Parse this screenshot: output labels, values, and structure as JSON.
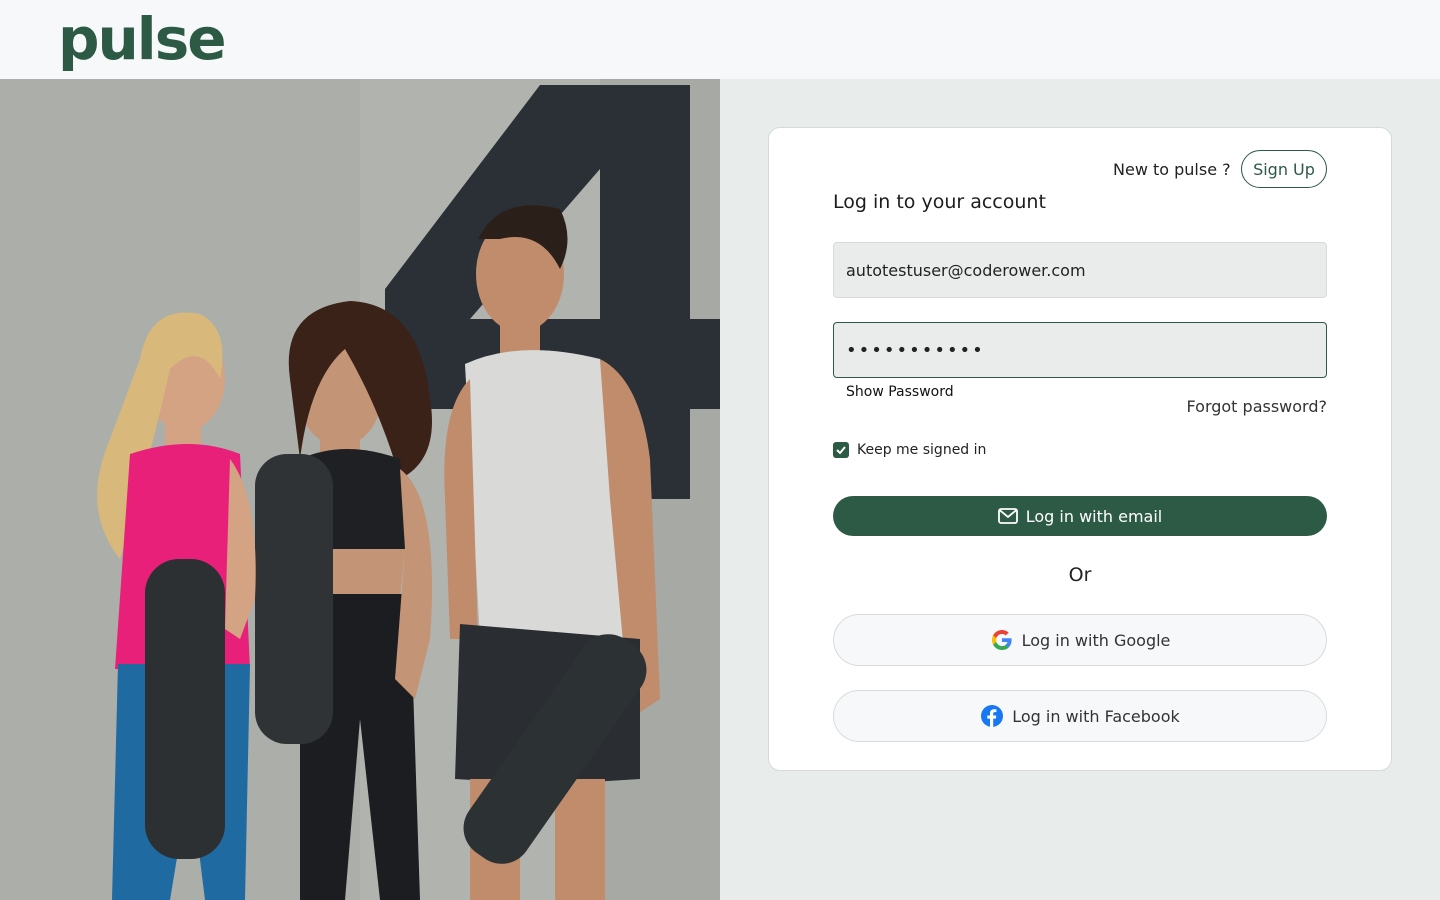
{
  "brand": {
    "logo_text": "pulse",
    "color": "#2c5a45"
  },
  "hero": {
    "image_alt": "fitness-group-photo"
  },
  "signup": {
    "prompt": "New to pulse ?",
    "button_label": "Sign Up"
  },
  "login": {
    "title": "Log in to your account",
    "email_value": "autotestuser@coderower.com",
    "password_masked": "•••••••••••",
    "show_password_label": "Show Password",
    "forgot_password_label": "Forgot password?",
    "keep_signed_in_label": "Keep me signed in",
    "keep_signed_in_checked": true,
    "email_button_label": "Log in with email",
    "or_label": "Or",
    "google_button_label": "Log in with Google",
    "facebook_button_label": "Log in with Facebook"
  },
  "colors": {
    "accent": "#2c5a45",
    "panel_bg": "#e8eceb",
    "header_bg": "#f7f8fa"
  }
}
